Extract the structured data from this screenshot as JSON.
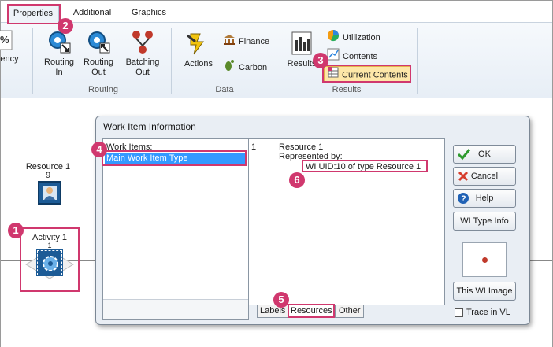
{
  "ribbon": {
    "tabs": [
      "Properties",
      "Additional",
      "Graphics"
    ],
    "partial_left_label": "ency",
    "routing": {
      "routing_in": "Routing\nIn",
      "routing_out": "Routing\nOut",
      "batching_out": "Batching\nOut",
      "group_label": "Routing"
    },
    "data": {
      "actions": "Actions",
      "finance": "Finance",
      "carbon": "Carbon",
      "group_label": "Data"
    },
    "results": {
      "results": "Results",
      "utilization": "Utilization",
      "contents": "Contents",
      "current_contents": "Current Contents",
      "group_label": "Results"
    }
  },
  "canvas": {
    "resource_label": "Resource 1",
    "resource_count": "9",
    "activity_label": "Activity 1",
    "activity_count": "1"
  },
  "dialog": {
    "title": "Work Item Information",
    "work_items_label": "Work Items:",
    "work_items": [
      "Main Work Item Type"
    ],
    "details": {
      "index": "1",
      "resource": "Resource 1",
      "represented_by": "Represented by:",
      "wi_uid": "WI UID:10 of type Resource 1"
    },
    "tabs": [
      "Labels",
      "Resources",
      "Other"
    ],
    "buttons": {
      "ok": "OK",
      "cancel": "Cancel",
      "help": "Help",
      "wi_type_info": "WI Type Info",
      "this_wi_image": "This WI Image"
    },
    "trace_label": "Trace in VL"
  },
  "callouts": [
    "1",
    "2",
    "3",
    "4",
    "5",
    "6"
  ],
  "colors": {
    "highlight": "#d0386e",
    "selection": "#3399ff"
  }
}
